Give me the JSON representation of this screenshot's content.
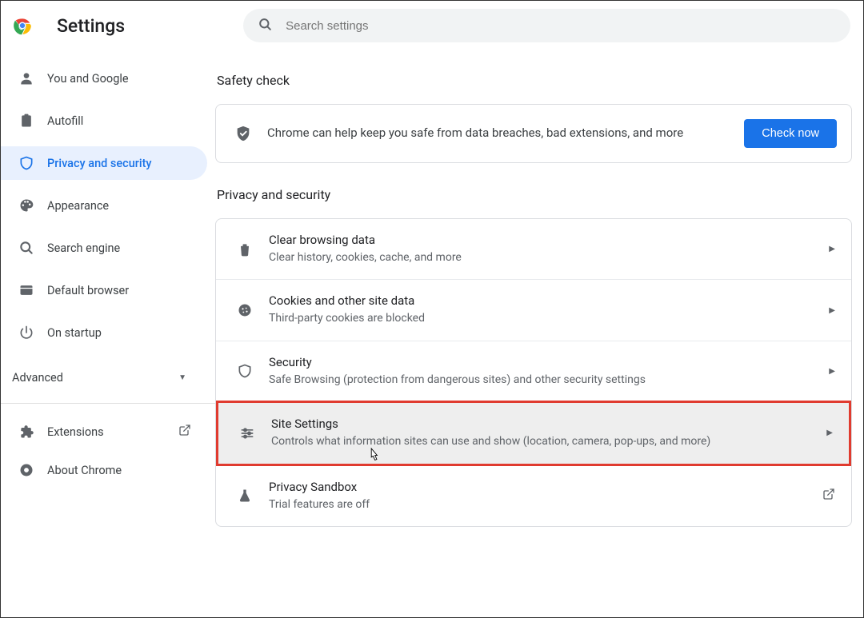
{
  "header": {
    "title": "Settings",
    "search_placeholder": "Search settings"
  },
  "sidebar": {
    "items": [
      {
        "label": "You and Google"
      },
      {
        "label": "Autofill"
      },
      {
        "label": "Privacy and security"
      },
      {
        "label": "Appearance"
      },
      {
        "label": "Search engine"
      },
      {
        "label": "Default browser"
      },
      {
        "label": "On startup"
      }
    ],
    "advanced_label": "Advanced",
    "extensions_label": "Extensions",
    "about_label": "About Chrome"
  },
  "sections": {
    "safety_check": {
      "title": "Safety check",
      "text": "Chrome can help keep you safe from data breaches, bad extensions, and more",
      "button": "Check now"
    },
    "privacy": {
      "title": "Privacy and security",
      "items": [
        {
          "title": "Clear browsing data",
          "desc": "Clear history, cookies, cache, and more"
        },
        {
          "title": "Cookies and other site data",
          "desc": "Third-party cookies are blocked"
        },
        {
          "title": "Security",
          "desc": "Safe Browsing (protection from dangerous sites) and other security settings"
        },
        {
          "title": "Site Settings",
          "desc": "Controls what information sites can use and show (location, camera, pop-ups, and more)"
        },
        {
          "title": "Privacy Sandbox",
          "desc": "Trial features are off"
        }
      ]
    }
  }
}
